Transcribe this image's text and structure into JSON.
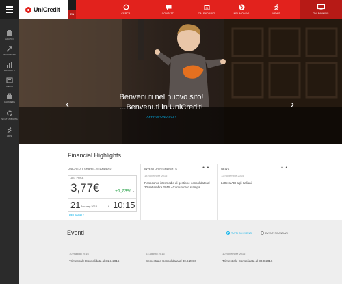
{
  "header": {
    "brand": "UniCredit",
    "lang_top": "",
    "lang_active": "EN",
    "nav": [
      {
        "label": "CERCA",
        "icon": "search-icon"
      },
      {
        "label": "CONTATTI",
        "icon": "chat-icon"
      },
      {
        "label": "CALENDARIO",
        "icon": "calendar-icon"
      },
      {
        "label": "NEL MONDO",
        "icon": "globe-icon"
      },
      {
        "label": "NEWS",
        "icon": "news-icon"
      }
    ],
    "bank_label": "ON. BANKING",
    "bank_icon": "monitor-icon"
  },
  "sidebar": {
    "items": [
      {
        "label": "GRUPPO",
        "icon": "group-icon"
      },
      {
        "label": "INVESTORS",
        "icon": "arrow-up-icon"
      },
      {
        "label": "PRODOTTI",
        "icon": "bar-chart-icon"
      },
      {
        "label": "MEDIA",
        "icon": "media-icon"
      },
      {
        "label": "CARRIERE",
        "icon": "briefcase-icon"
      },
      {
        "label": "SOSTENIBILITÀ",
        "icon": "recycle-icon"
      },
      {
        "label": "ARTE",
        "icon": "runner-icon"
      }
    ]
  },
  "hero": {
    "line1": "Benvenuti nel nuovo sito!",
    "line2": "...Benvenuti in UniCredit!",
    "link": "APPROFONDISCI ›"
  },
  "financial": {
    "title": "Financial Highlights",
    "stock_header": "UNICREDIT SHARE - STANDARD",
    "stock_label": "LAST PRICE",
    "price": "3,77€",
    "change": "+1,73%",
    "day": "21",
    "date_label": "January 2016",
    "h_label": "h",
    "time": "10:15",
    "details": "DETTAGLI ›",
    "col2_header": "INVESTOR HIGHLIGHTS",
    "col2_date": "18 novembre 2015",
    "col2_text": "Resoconto intermedio di gestione consolidato al 30 settembre 2015 - Comunicato stampa",
    "col3_header": "NEWS",
    "col3_date": "12 novembre 2015",
    "col3_text": "Lettera ABI agli Italiani"
  },
  "events": {
    "title": "Eventi",
    "filter_all": "TUTTI GLI EVENTI",
    "filter_fin": "EVENTI FINANZIARI",
    "items": [
      {
        "date": "10 maggio 2016",
        "title": "Trimestrale Consolidata al 31.3.2016"
      },
      {
        "date": "03 agosto 2016",
        "title": "Semestrale Consolidata al 30.6.2016"
      },
      {
        "date": "10 novembre 2016",
        "title": "Trimestrale Consolidata al 30.9.2016"
      }
    ]
  },
  "colors": {
    "brand_red": "#e2221d",
    "dark_red": "#b71a16",
    "sidebar": "#2b2b2b",
    "accent_blue": "#00aee8",
    "positive_green": "#2aa34a"
  }
}
